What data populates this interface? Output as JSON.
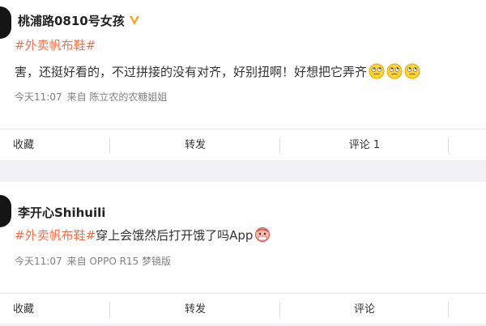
{
  "posts": [
    {
      "username": "桃浦路0810号女孩",
      "verified_badge": "yellow-v-icon",
      "topic": "#外卖帆布鞋#",
      "text": "害，还挺好看的，不过拼接的没有对齐，好别扭啊！好想把它弄齐",
      "emoji": [
        "eye-roll-emoji-icon",
        "eye-roll-emoji-icon",
        "eye-roll-emoji-icon"
      ],
      "time": "今天11:07",
      "source": "来自 陈立农的农糖姐姐",
      "actions": {
        "favorite": "收藏",
        "repost": "转发",
        "comment": "评论 1"
      }
    },
    {
      "username": "李开心Shihuili",
      "topic": "#外卖帆布鞋#",
      "text": "穿上会饿然后打开饿了吗App",
      "emoji": [
        "mask-face-emoji-icon"
      ],
      "time": "今天11:07",
      "source": "来自 OPPO R15 梦镜版",
      "actions": {
        "favorite": "收藏",
        "repost": "转发",
        "comment": "评论"
      }
    }
  ],
  "colors": {
    "topic": "#eb7350",
    "badge": "#f5a623",
    "background": "#f2f2f5"
  }
}
